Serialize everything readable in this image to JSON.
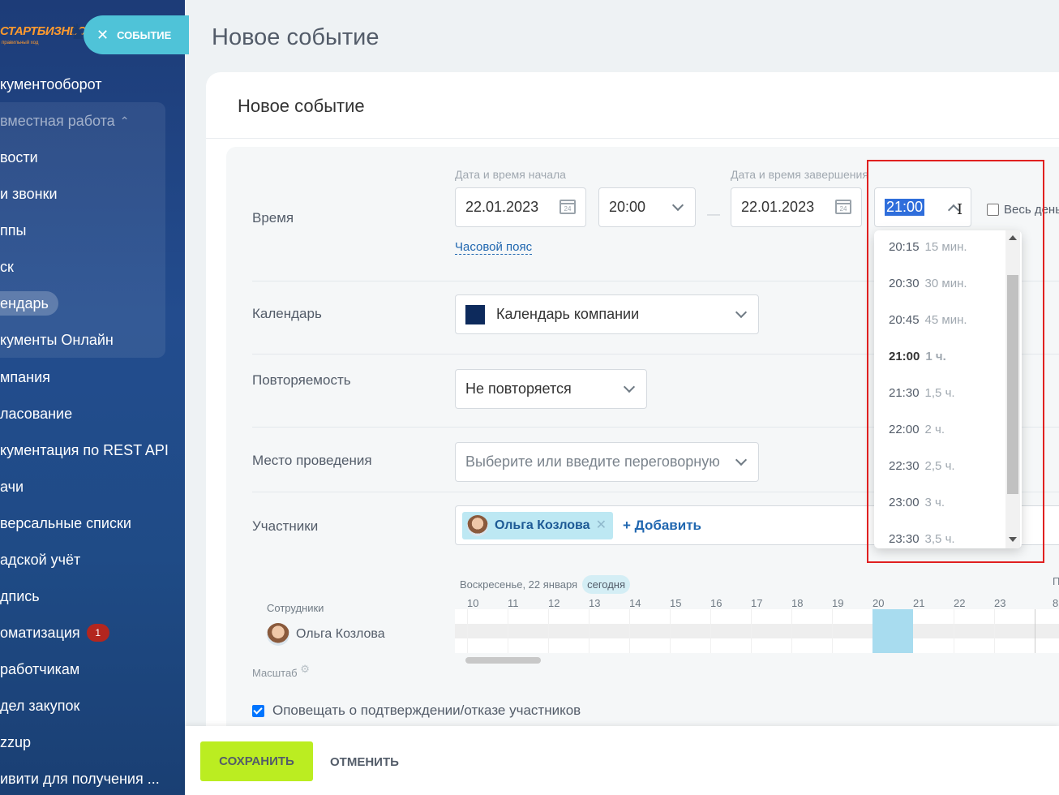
{
  "sidebar": {
    "logo_text": "СТАРТБИЗНЕС",
    "logo_sub": "правильный ход",
    "close_label": "СОБЫТИЕ",
    "items": [
      {
        "label": "кументооборот"
      },
      {
        "label": "вместная работа"
      },
      {
        "label": "вости"
      },
      {
        "label": " и звонки"
      },
      {
        "label": "ппы"
      },
      {
        "label": "ск"
      },
      {
        "label": "ендарь"
      },
      {
        "label": "кументы Онлайн"
      },
      {
        "label": "мпания"
      },
      {
        "label": "ласование"
      },
      {
        "label": "кументация по REST API"
      },
      {
        "label": "ачи"
      },
      {
        "label": "версальные списки"
      },
      {
        "label": "адской учёт"
      },
      {
        "label": "дпись"
      },
      {
        "label": "оматизация"
      },
      {
        "label": "работчикам"
      },
      {
        "label": "дел закупок"
      },
      {
        "label": "zzup"
      },
      {
        "label": "ивити для получения ..."
      }
    ],
    "automation_badge": "1"
  },
  "page": {
    "title": "Новое событие",
    "card_title": "Новое событие"
  },
  "time": {
    "label": "Время",
    "start_label": "Дата и время начала",
    "end_label": "Дата и время завершения",
    "start_date": "22.01.2023",
    "start_time": "20:00",
    "dash": "—",
    "end_date": "22.01.2023",
    "end_time": "21:00",
    "allday_label": "Весь день",
    "timezone_link": "Часовой пояс"
  },
  "time_dropdown": {
    "options": [
      {
        "time": "20:15",
        "dur": "15 мин."
      },
      {
        "time": "20:30",
        "dur": "30 мин."
      },
      {
        "time": "20:45",
        "dur": "45 мин."
      },
      {
        "time": "21:00",
        "dur": "1 ч."
      },
      {
        "time": "21:30",
        "dur": "1,5 ч."
      },
      {
        "time": "22:00",
        "dur": "2 ч."
      },
      {
        "time": "22:30",
        "dur": "2,5 ч."
      },
      {
        "time": "23:00",
        "dur": "3 ч."
      },
      {
        "time": "23:30",
        "dur": "3,5 ч."
      }
    ],
    "selected": "21:00"
  },
  "calendar": {
    "label": "Календарь",
    "value": "Календарь компании",
    "color": "#0d2a5c"
  },
  "repeat": {
    "label": "Повторяемость",
    "value": "Не повторяется"
  },
  "location": {
    "label": "Место проведения",
    "placeholder": "Выберите или введите переговорную"
  },
  "participants": {
    "label": "Участники",
    "chip_name": "Ольга Козлова",
    "add_label": "+ Добавить"
  },
  "planner": {
    "date_label": "Воскресенье, 22 января",
    "today_label": "сегодня",
    "hours": [
      "10",
      "11",
      "12",
      "13",
      "14",
      "15",
      "16",
      "17",
      "18",
      "19",
      "20",
      "21",
      "22",
      "23"
    ],
    "next_hour": "8",
    "next_day_letter": "П",
    "staff_label": "Сотрудники",
    "staff_name": "Ольга Козлова",
    "scale_label": "Масштаб"
  },
  "notify": {
    "label": "Оповещать о подтверждении/отказе участников",
    "checked": true
  },
  "footer": {
    "save_label": "СОХРАНИТЬ",
    "cancel_label": "ОТМЕНИТЬ"
  }
}
